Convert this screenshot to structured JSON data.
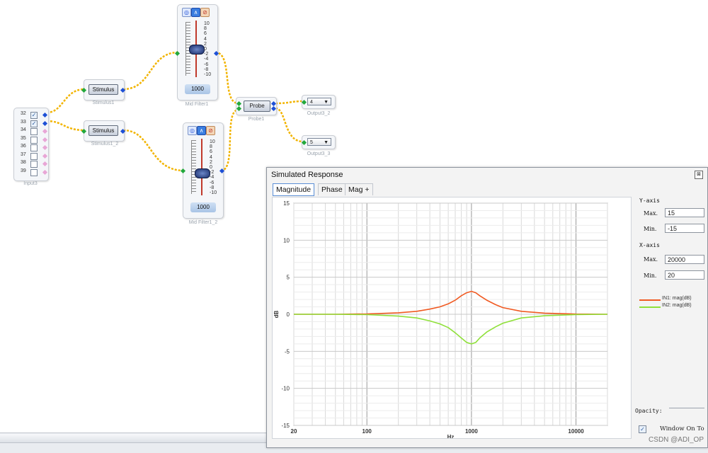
{
  "input_block": {
    "caption": "Input3",
    "rows": [
      {
        "num": "32",
        "checked": true
      },
      {
        "num": "33",
        "checked": true
      },
      {
        "num": "34",
        "checked": false
      },
      {
        "num": "35",
        "checked": false
      },
      {
        "num": "36",
        "checked": false
      },
      {
        "num": "37",
        "checked": false
      },
      {
        "num": "38",
        "checked": false
      },
      {
        "num": "39",
        "checked": false
      }
    ]
  },
  "stimulus1": {
    "label": "Stimulus",
    "caption": "Stimulus1"
  },
  "stimulus2": {
    "label": "Stimulus",
    "caption": "Stimulus1_2"
  },
  "filter1": {
    "caption": "Mid Filter1",
    "value": "1000",
    "scale": [
      "10",
      "8",
      "6",
      "4",
      "2",
      "0",
      "-2",
      "-4",
      "-6",
      "-8",
      "-10"
    ],
    "level_db": 0
  },
  "filter2": {
    "caption": "Mid Filter1_2",
    "value": "1000",
    "scale": [
      "10",
      "8",
      "6",
      "4",
      "2",
      "0",
      "-2",
      "-4",
      "-6",
      "-8",
      "-10"
    ],
    "level_db": -2
  },
  "probe": {
    "label": "Probe",
    "caption": "Probe1"
  },
  "output1": {
    "value": "4",
    "caption": "Output3_2"
  },
  "output2": {
    "value": "5",
    "caption": "Output3_3"
  },
  "window": {
    "title": "Simulated Response",
    "close_glyph": "⊠",
    "tabs": [
      {
        "label": "Magnitude",
        "active": true
      },
      {
        "label": "Phase",
        "active": false
      },
      {
        "label": "Mag + Phase",
        "active": false
      }
    ],
    "y_axis": {
      "group": "Y-axis",
      "max_label": "Max.",
      "max_value": "15",
      "min_label": "Min.",
      "min_value": "-15"
    },
    "x_axis": {
      "group": "X-axis",
      "max_label": "Max.",
      "max_value": "20000",
      "min_label": "Min.",
      "min_value": "20"
    },
    "opacity_label": "Opacity:",
    "window_on_top_label": "Window On To",
    "window_on_top_checked": true
  },
  "colors": {
    "series1": "#f05a22",
    "series2": "#8fe03a",
    "wire": "#f2b400",
    "wire_dot": "#e58a00"
  },
  "icons": {
    "filter_icons": [
      "target-icon",
      "peak-filter-icon",
      "bypass-icon"
    ],
    "dropdown": "dropdown-arrow-icon"
  },
  "watermark": "CSDN @ADI_OP",
  "chart_data": {
    "type": "line",
    "xlabel": "Hz",
    "ylabel": "dB",
    "xscale": "log",
    "xlim": [
      20,
      20000
    ],
    "ylim": [
      -15,
      15
    ],
    "x_ticks": [
      "20",
      "100",
      "1000",
      "10000"
    ],
    "y_ticks": [
      "15",
      "10",
      "5",
      "0",
      "-5",
      "-10",
      "-15"
    ],
    "grid": true,
    "legend_position": "right",
    "series": [
      {
        "name": "IN1: mag(dB)",
        "color": "#f05a22",
        "x": [
          20,
          50,
          100,
          200,
          300,
          400,
          500,
          600,
          700,
          800,
          900,
          1000,
          1100,
          1200,
          1400,
          1700,
          2000,
          3000,
          5000,
          10000,
          20000
        ],
        "y": [
          0,
          0,
          0.05,
          0.2,
          0.4,
          0.7,
          1.0,
          1.4,
          1.9,
          2.5,
          2.9,
          3.1,
          2.9,
          2.5,
          1.9,
          1.3,
          0.9,
          0.4,
          0.15,
          0.03,
          0
        ]
      },
      {
        "name": "IN2: mag(dB)",
        "color": "#8fe03a",
        "x": [
          20,
          50,
          100,
          200,
          300,
          400,
          500,
          600,
          700,
          800,
          900,
          1000,
          1100,
          1200,
          1400,
          1700,
          2000,
          3000,
          5000,
          10000,
          20000
        ],
        "y": [
          0,
          0,
          -0.05,
          -0.25,
          -0.5,
          -0.9,
          -1.3,
          -1.8,
          -2.5,
          -3.2,
          -3.8,
          -4.0,
          -3.8,
          -3.2,
          -2.4,
          -1.7,
          -1.2,
          -0.5,
          -0.2,
          -0.04,
          0
        ]
      }
    ]
  }
}
